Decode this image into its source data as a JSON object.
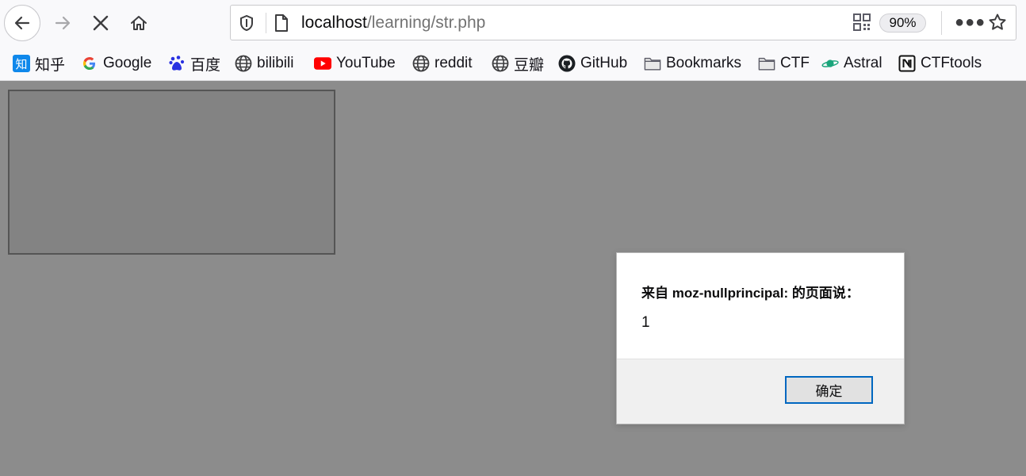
{
  "toolbar": {
    "back_icon": "arrow-left-icon",
    "forward_icon": "arrow-right-icon",
    "stop_icon": "close-icon",
    "home_icon": "home-icon"
  },
  "urlbar": {
    "host": "localhost",
    "path": "/learning/str.php",
    "zoom": "90%"
  },
  "bookmarks": [
    {
      "label": "知乎",
      "icon": "zhihu-icon"
    },
    {
      "label": "Google",
      "icon": "google-icon"
    },
    {
      "label": "百度",
      "icon": "baidu-icon"
    },
    {
      "label": "bilibili",
      "icon": "globe-icon"
    },
    {
      "label": "YouTube",
      "icon": "youtube-icon"
    },
    {
      "label": "reddit",
      "icon": "globe-icon"
    },
    {
      "label": "豆瓣",
      "icon": "globe-icon"
    },
    {
      "label": "GitHub",
      "icon": "github-icon"
    },
    {
      "label": "Bookmarks",
      "icon": "folder-icon"
    },
    {
      "label": "CTF",
      "icon": "folder-icon"
    },
    {
      "label": "Astral",
      "icon": "planet-icon"
    },
    {
      "label": "CTFtools",
      "icon": "notion-icon"
    }
  ],
  "dialog": {
    "title": "来自 moz-nullprincipal: 的页面说：",
    "message": "1",
    "ok_label": "确定"
  },
  "colors": {
    "page_background": "#8c8c8c",
    "dialog_button_border": "#0067c0"
  }
}
